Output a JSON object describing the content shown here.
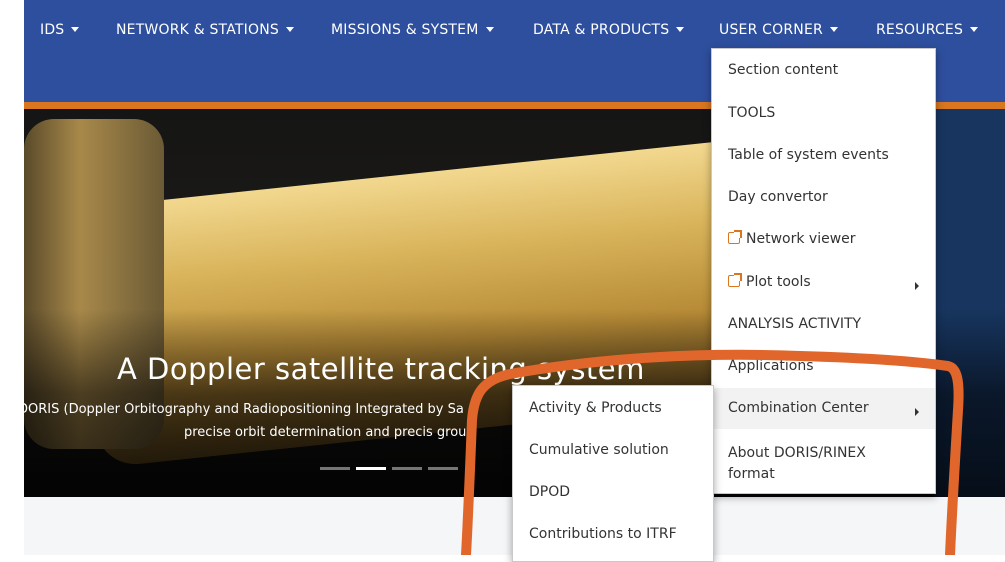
{
  "navbar": {
    "items": [
      {
        "label": "IDS"
      },
      {
        "label": "NETWORK & STATIONS"
      },
      {
        "label": "MISSIONS & SYSTEM"
      },
      {
        "label": "DATA & PRODUCTS"
      },
      {
        "label": "USER CORNER"
      },
      {
        "label": "RESOURCES"
      }
    ]
  },
  "hero": {
    "title": "A Doppler satellite tracking system",
    "caption_line1": "DORIS (Doppler Orbitography and Radiopositioning Integrated by Sa",
    "caption_line2": "precise orbit determination and precis  grou",
    "slide_count": 4,
    "active_slide": 2
  },
  "user_corner_menu": {
    "items": [
      {
        "label": "Section content",
        "type": "link"
      },
      {
        "label": "TOOLS",
        "type": "header"
      },
      {
        "label": "Table of system events",
        "type": "link"
      },
      {
        "label": "Day convertor",
        "type": "link"
      },
      {
        "label": "Network viewer",
        "type": "external"
      },
      {
        "label": "Plot tools",
        "type": "external-submenu"
      },
      {
        "label": "ANALYSIS ACTIVITY",
        "type": "header"
      },
      {
        "label": "Applications",
        "type": "link"
      },
      {
        "label": "Combination Center",
        "type": "submenu"
      },
      {
        "label": "About DORIS/RINEX",
        "label2": "format",
        "type": "link"
      }
    ]
  },
  "combination_submenu": {
    "items": [
      {
        "label": "Activity & Products"
      },
      {
        "label": "Cumulative solution"
      },
      {
        "label": "DPOD"
      },
      {
        "label": "Contributions to ITRF"
      }
    ]
  },
  "colors": {
    "navbar": "#2e4f9d",
    "accent_orange": "#d9761f",
    "annotation": "#e0662c"
  },
  "icons": {
    "external_link": "external-link-icon",
    "submenu_arrow": "chevron-right-icon",
    "dropdown_caret": "caret-down-icon"
  }
}
